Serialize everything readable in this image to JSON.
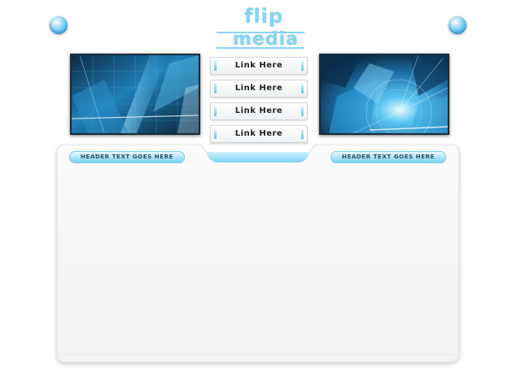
{
  "logo": {
    "line1": "flip",
    "line2": "media",
    "color": "#8ad4f4"
  },
  "nav": {
    "links": [
      {
        "label": "Link Here"
      },
      {
        "label": "Link Here"
      },
      {
        "label": "Link Here"
      },
      {
        "label": "Link Here"
      }
    ]
  },
  "panel": {
    "header_left": "HEADER TEXT GOES HERE",
    "header_right": "HEADER TEXT GOES HERE"
  },
  "colors": {
    "accent": "#6cc9f2",
    "accent_dark": "#2a9ad8",
    "panel_bg": "#f4f4f4",
    "page_bg": "#ffffff"
  }
}
